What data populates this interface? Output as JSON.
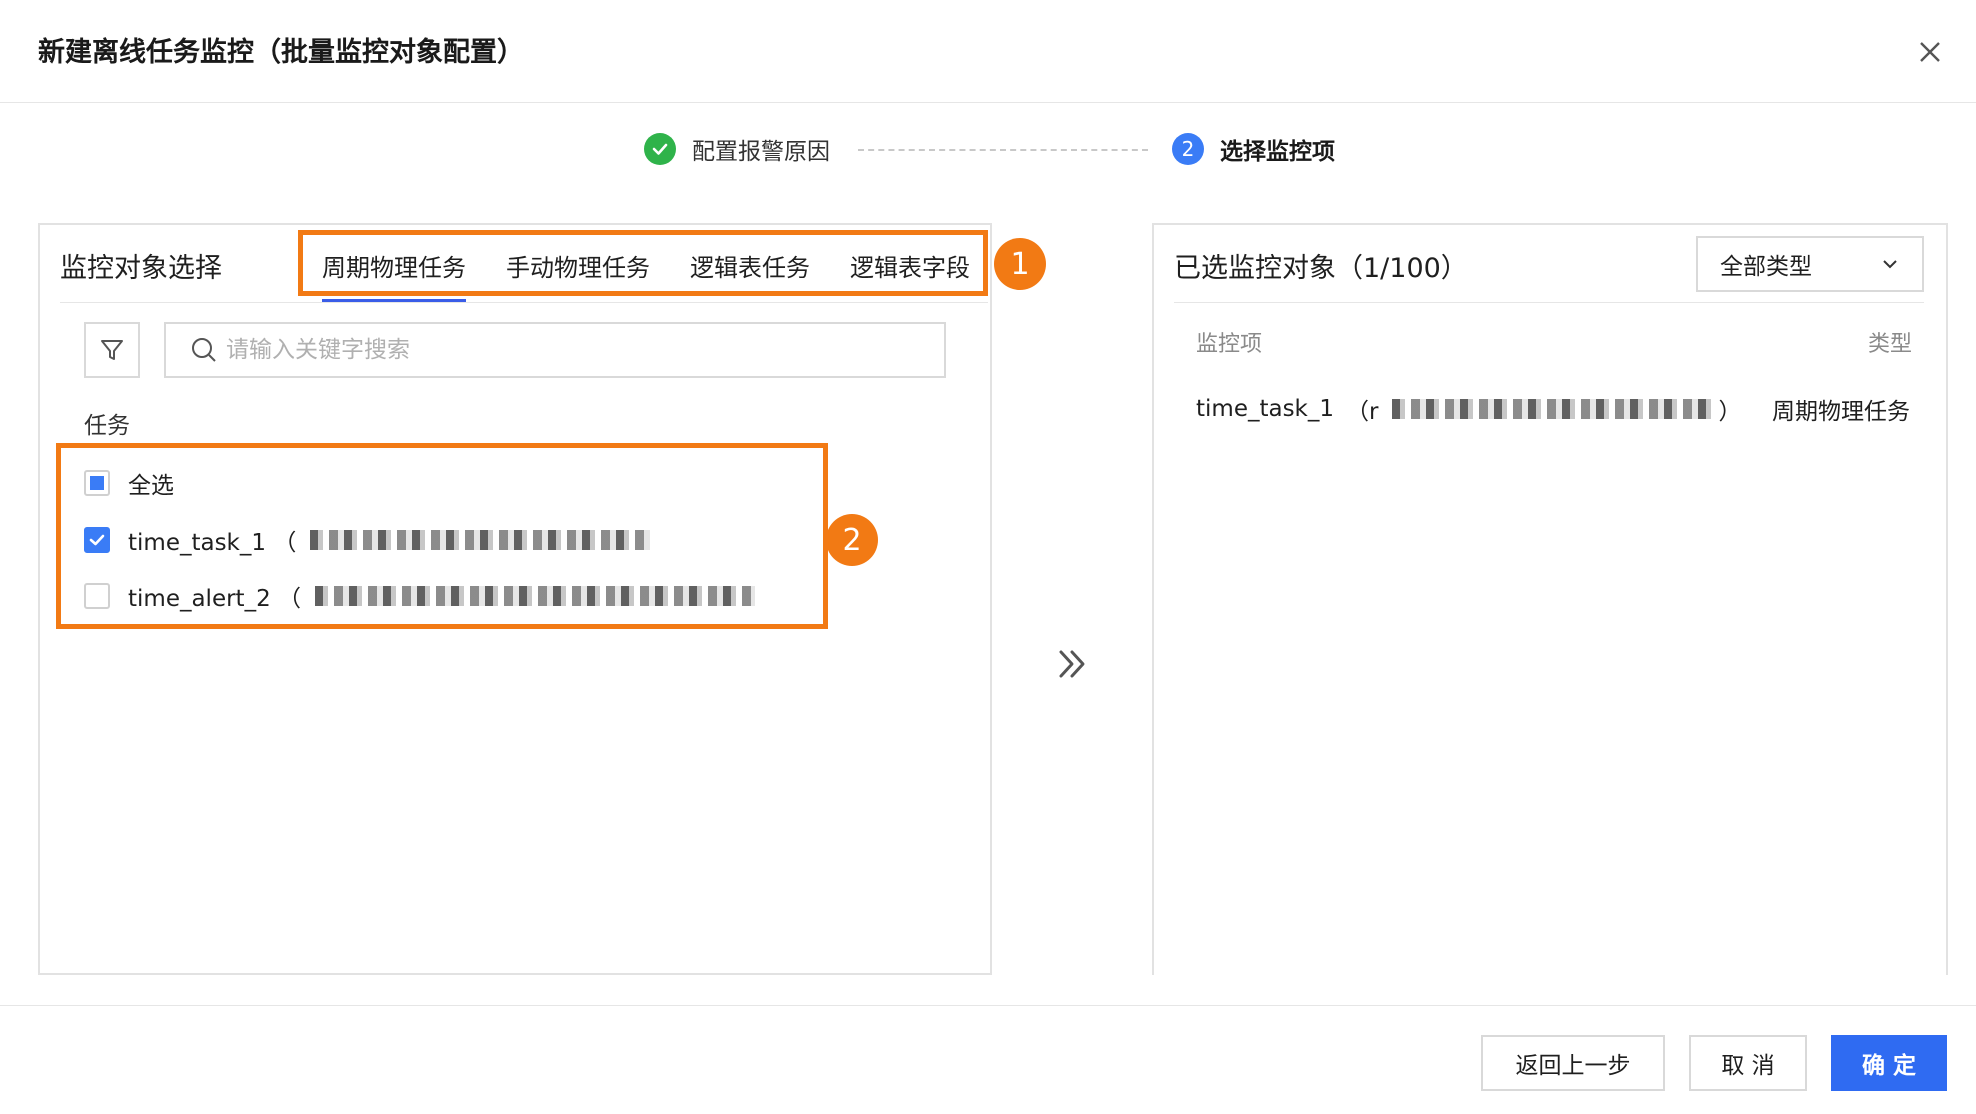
{
  "dialog": {
    "title": "新建离线任务监控（批量监控对象配置）"
  },
  "steps": [
    {
      "number": "1",
      "label": "配置报警原因",
      "status": "done"
    },
    {
      "number": "2",
      "label": "选择监控项",
      "status": "active"
    }
  ],
  "left_panel": {
    "title": "监控对象选择",
    "tabs": [
      "周期物理任务",
      "手动物理任务",
      "逻辑表任务",
      "逻辑表字段"
    ],
    "active_tab": "周期物理任务",
    "search": {
      "placeholder": "请输入关键字搜索",
      "value": ""
    },
    "section_label": "任务",
    "items": [
      {
        "label": "全选",
        "state": "indeterminate"
      },
      {
        "label": "time_task_1",
        "suffix": "（",
        "state": "checked"
      },
      {
        "label": "time_alert_2",
        "suffix": "（",
        "state": "unchecked"
      }
    ]
  },
  "annotations": {
    "badge1": "1",
    "badge2": "2",
    "highlight_color": "#f27a14"
  },
  "right_panel": {
    "title": "已选监控对象（1/100）",
    "type_select": {
      "value": "全部类型"
    },
    "columns": [
      "监控项",
      "类型"
    ],
    "selected": [
      {
        "name": "time_task_1",
        "prefix": "（r",
        "close": "）",
        "type": "周期物理任务"
      }
    ]
  },
  "footer": {
    "back_label": "返回上一步",
    "cancel_label": "取 消",
    "confirm_label": "确 定"
  },
  "colors": {
    "accent": "#3a7cf6",
    "success": "#2fb34a",
    "primary_button": "#2f6bf2"
  }
}
